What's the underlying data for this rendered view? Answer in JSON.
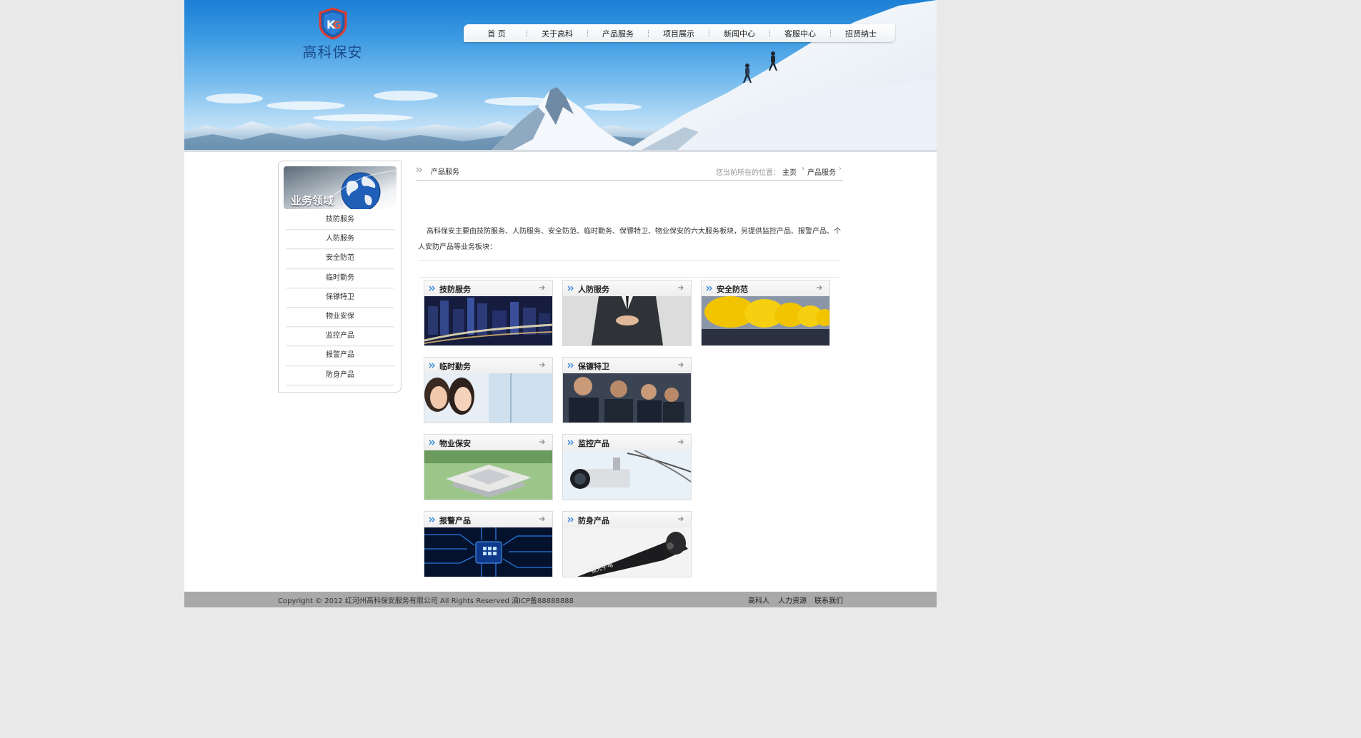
{
  "site": {
    "logo_text": "高科保安",
    "logo_mark": "KG"
  },
  "nav": {
    "items": [
      {
        "label": "首 页"
      },
      {
        "label": "关于高科"
      },
      {
        "label": "产品服务"
      },
      {
        "label": "项目展示"
      },
      {
        "label": "新闻中心"
      },
      {
        "label": "客服中心"
      },
      {
        "label": "招贤纳士"
      }
    ]
  },
  "sidebar": {
    "title": "业务领域",
    "items": [
      {
        "label": "技防服务"
      },
      {
        "label": "人防服务"
      },
      {
        "label": "安全防范"
      },
      {
        "label": "临时勤务"
      },
      {
        "label": "保镖特卫"
      },
      {
        "label": "物业安保"
      },
      {
        "label": "监控产品"
      },
      {
        "label": "报警产品"
      },
      {
        "label": "防身产品"
      }
    ]
  },
  "content": {
    "section_title": "产品服务",
    "location_label": "您当前所在的位置：",
    "breadcrumb": {
      "home": "主页",
      "current": "产品服务"
    },
    "intro": "高科保安主要由技防服务、人防服务、安全防范、临时勤务、保镖特卫、物业保安的六大服务板块，另提供监控产品、报警产品、个人安防产品等业务板块："
  },
  "cards": [
    {
      "label": "技防服务",
      "image": "city-night-skyline"
    },
    {
      "label": "人防服务",
      "image": "suited-guard-hands"
    },
    {
      "label": "安全防范",
      "image": "yellow-helmets-row"
    },
    {
      "label": "临时勤务",
      "image": "smiling-women-office"
    },
    {
      "label": "保镖特卫",
      "image": "uniformed-guards-team"
    },
    {
      "label": "物业保安",
      "image": "building-complex-aerial"
    },
    {
      "label": "监控产品",
      "image": "cctv-camera"
    },
    {
      "label": "报警产品",
      "image": "circuit-board-chip"
    },
    {
      "label": "防身产品",
      "image": "tactical-flashlight",
      "image_text": "强光手电"
    }
  ],
  "footer": {
    "copyright": "Copyright © 2012 红河州高科保安服务有限公司 All Rights Reserved 滇ICP备88888888",
    "links": [
      {
        "label": "高科人"
      },
      {
        "label": "人力资源"
      },
      {
        "label": "联系我们"
      }
    ]
  },
  "icons": {
    "nav_separator": "dotted-divider",
    "crumb_arrow": "double-chevron-right-icon",
    "card_bullet": "double-chevron-right-icon",
    "card_more": "arrow-right-icon"
  },
  "colors": {
    "sky_blue": "#3b9ae2",
    "logo_blue": "#1a4a8a",
    "footer_gray": "#a9a9a9",
    "body_bg": "#e9e9e9"
  }
}
